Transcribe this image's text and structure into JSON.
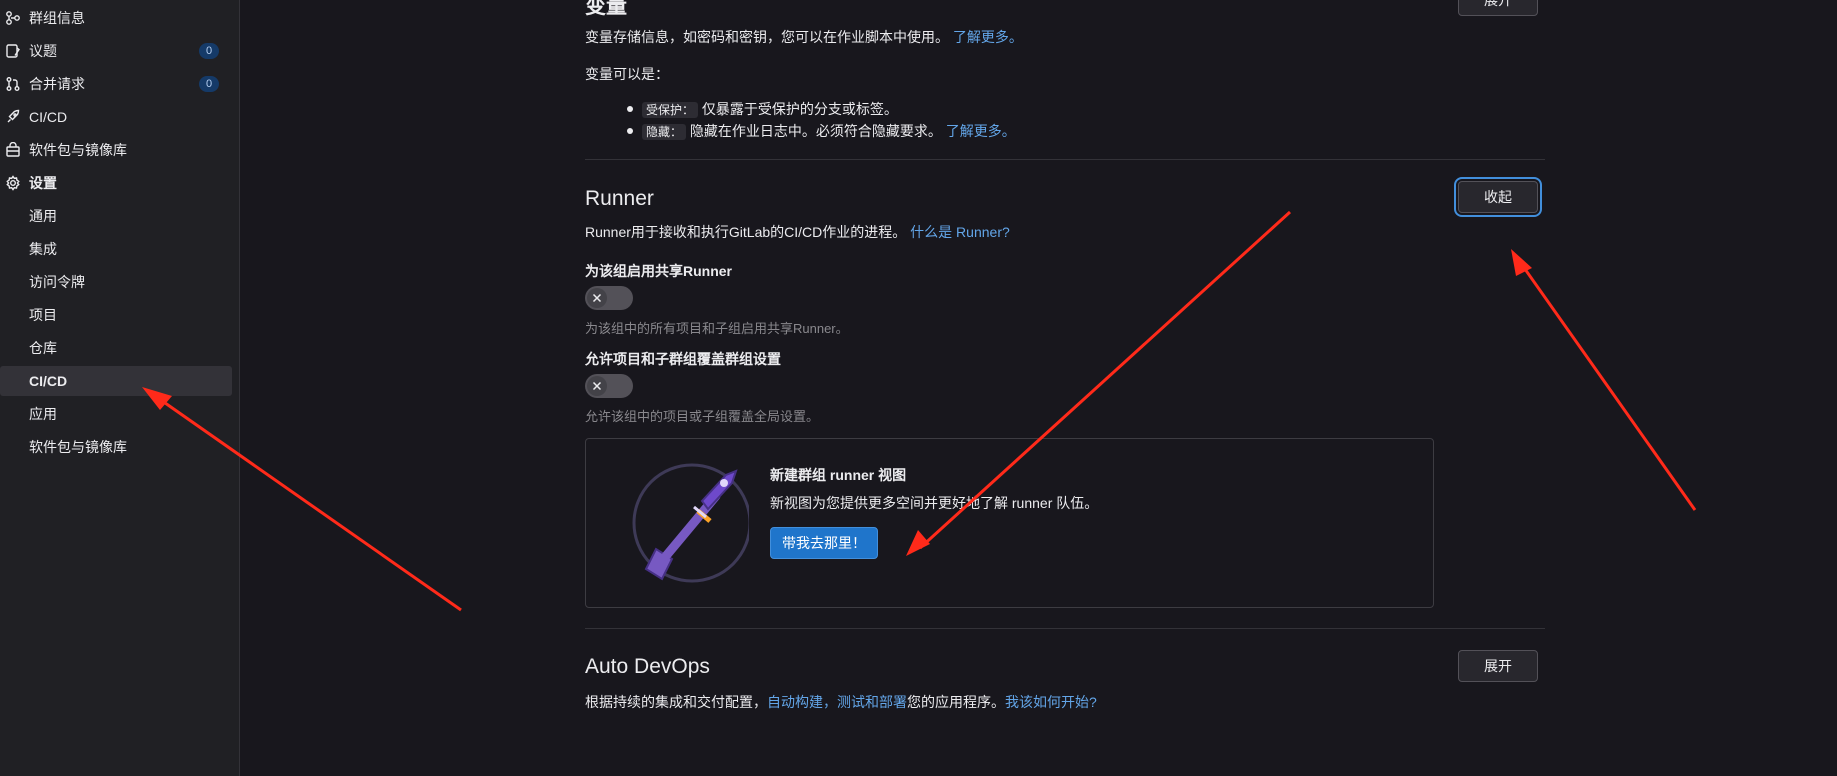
{
  "sidebar": {
    "items": [
      {
        "label": "群组信息",
        "icon": "group-icon"
      },
      {
        "label": "议题",
        "icon": "issues-icon",
        "badge": "0"
      },
      {
        "label": "合并请求",
        "icon": "merge-request-icon",
        "badge": "0"
      },
      {
        "label": "CI/CD",
        "icon": "rocket-icon"
      },
      {
        "label": "软件包与镜像库",
        "icon": "package-icon"
      },
      {
        "label": "设置",
        "icon": "settings-icon"
      }
    ],
    "settings_sub": [
      "通用",
      "集成",
      "访问令牌",
      "项目",
      "仓库",
      "CI/CD",
      "应用",
      "软件包与镜像库"
    ]
  },
  "variables": {
    "title": "变量",
    "expand_label": "展开",
    "desc_text": "变量存储信息，如密码和密钥，您可以在作业脚本中使用。",
    "desc_link": "了解更多。",
    "can_be": "变量可以是：",
    "protected_code": "受保护：",
    "protected_text": "仅暴露于受保护的分支或标签。",
    "masked_code": "隐藏：",
    "masked_text": "隐藏在作业日志中。必须符合隐藏要求。",
    "masked_link": "了解更多。"
  },
  "runner": {
    "title": "Runner",
    "collapse_label": "收起",
    "desc_text": "Runner用于接收和执行GitLab的CI/CD作业的进程。",
    "desc_link": "什么是 Runner?",
    "shared_label": "为该组启用共享Runner",
    "shared_help": "为该组中的所有项目和子组启用共享Runner。",
    "override_label": "允许项目和子群组覆盖群组设置",
    "override_help": "允许该组中的项目或子组覆盖全局设置。",
    "card_title": "新建群组 runner 视图",
    "card_text": "新视图为您提供更多空间并更好地了解 runner 队伍。",
    "card_button": "带我去那里！"
  },
  "autodevops": {
    "title": "Auto DevOps",
    "expand_label": "展开",
    "desc_text": "根据持续的集成和交付配置，",
    "desc_link1": "自动构建，测试和部署",
    "desc_mid": "您的应用程序。",
    "desc_link2": "我该如何开始?"
  },
  "colors": {
    "background": "#18171d",
    "sidebar": "#202024",
    "link": "#63a6e9",
    "primary": "#1f75cb",
    "annotation_arrow": "#ff2a1a"
  }
}
